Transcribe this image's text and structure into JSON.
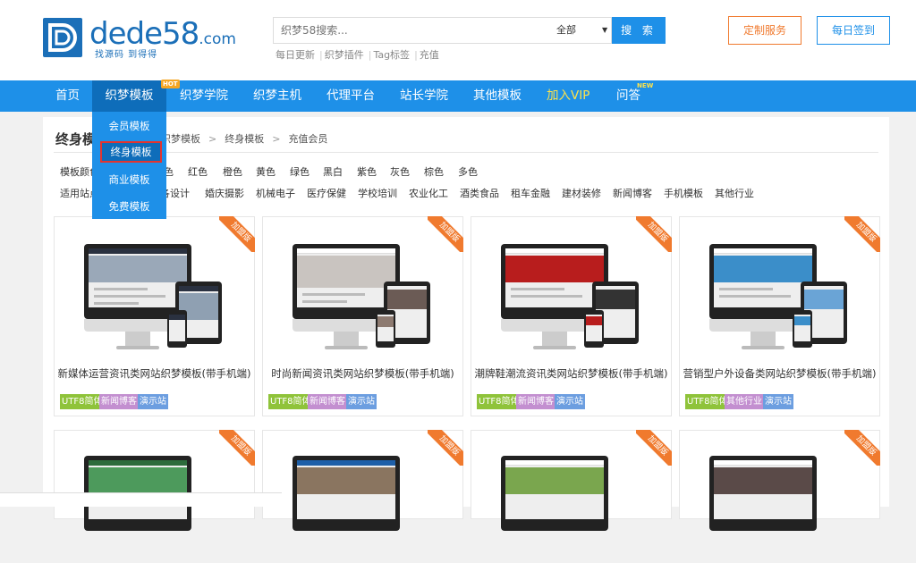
{
  "header": {
    "logo_text": "dede58",
    "logo_com": ".com",
    "logo_slogan": "找源码 到得得",
    "search_placeholder": "织梦58搜索...",
    "search_scope": "全部",
    "search_button": "搜 索",
    "hot_links": [
      "每日更新",
      "织梦插件",
      "Tag标签",
      "充值"
    ],
    "custom_service": "定制服务",
    "daily_signin": "每日签到"
  },
  "nav": {
    "items": [
      {
        "label": "首页"
      },
      {
        "label": "织梦模板",
        "active": true,
        "badge": "HOT"
      },
      {
        "label": "织梦学院"
      },
      {
        "label": "织梦主机"
      },
      {
        "label": "代理平台"
      },
      {
        "label": "站长学院"
      },
      {
        "label": "其他模板"
      },
      {
        "label": "加入VIP",
        "vip": true
      },
      {
        "label": "问答",
        "badge": "NEW"
      }
    ],
    "dropdown": [
      "会员模板",
      "终身模板",
      "商业模板",
      "免费模板"
    ]
  },
  "main": {
    "page_title": "终身模",
    "breadcrumb": [
      "织梦模板",
      "终身模板",
      "充值会员"
    ],
    "colors_label": "模板颜色",
    "colors": [
      "色",
      "红色",
      "橙色",
      "黄色",
      "绿色",
      "黑白",
      "紫色",
      "灰色",
      "棕色",
      "多色"
    ],
    "industry_label": "适用站点",
    "industries": [
      "各设计",
      "婚庆摄影",
      "机械电子",
      "医疗保健",
      "学校培训",
      "农业化工",
      "酒类食品",
      "租车金融",
      "建材装修",
      "新闻博客",
      "手机模板",
      "其他行业"
    ],
    "ribbon_text": "加盟版",
    "cards": [
      {
        "title": "新媒体运营资讯类网站织梦模板(带手机端)",
        "tags": [
          "UTF8简体",
          "新闻博客",
          "演示站"
        ]
      },
      {
        "title": "时尚新闻资讯类网站织梦模板(带手机端)",
        "tags": [
          "UTF8简体",
          "新闻博客",
          "演示站"
        ]
      },
      {
        "title": "潮牌鞋潮流资讯类网站织梦模板(带手机端)",
        "tags": [
          "UTF8简体",
          "新闻博客",
          "演示站"
        ]
      },
      {
        "title": "营销型户外设备类网站织梦模板(带手机端)",
        "tags": [
          "UTF8简体",
          "其他行业",
          "演示站"
        ]
      }
    ]
  },
  "colors": {
    "brand_blue": "#1e90e8",
    "accent_orange": "#f07a2e"
  }
}
